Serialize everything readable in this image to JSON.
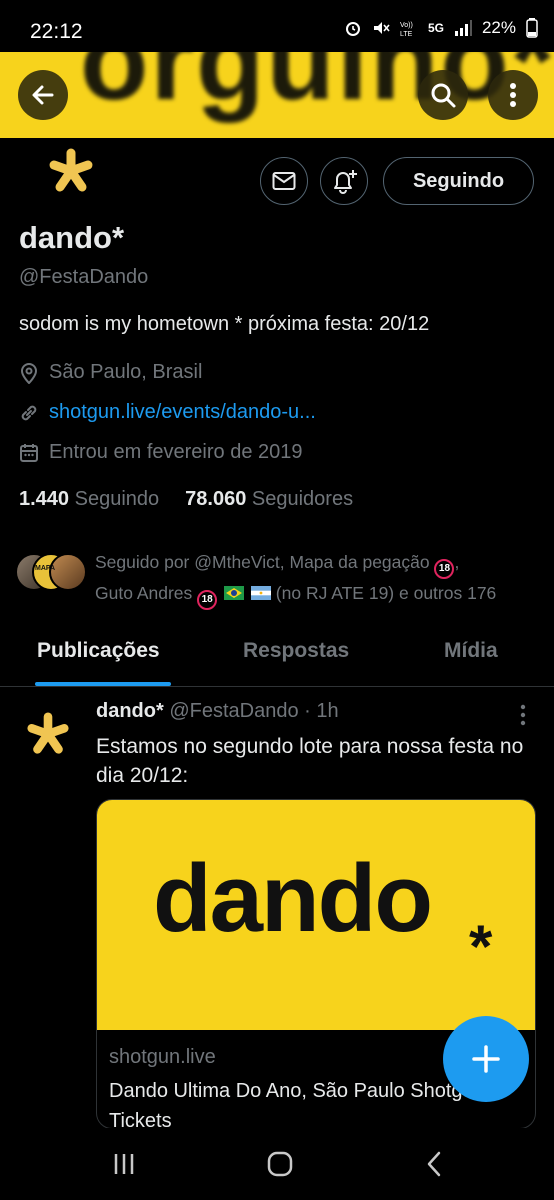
{
  "status_bar": {
    "time": "22:12",
    "battery": "22%",
    "network": "5G"
  },
  "banner": {
    "text": "orgulho*",
    "color": "#f7d31c"
  },
  "profile": {
    "display_name": "dando*",
    "handle": "@FestaDando",
    "bio": "sodom is my hometown * próxima festa: 20/12",
    "location": "São Paulo, Brasil",
    "link": "shotgun.live/events/dando-u...",
    "joined": "Entrou em fevereiro de 2019",
    "following_count": "1.440",
    "following_label": "Seguindo",
    "followers_count": "78.060",
    "followers_label": "Seguidores",
    "follow_button": "Seguindo",
    "followed_by_line1": "Seguido por @MtheVict, Mapa da pegação",
    "followed_by_line2_a": "Guto Andres",
    "followed_by_line2_b": "(no RJ ATE 19) e outros 176",
    "badge_18": "18",
    "followed_avatar_badge": "MAPA"
  },
  "tabs": [
    {
      "label": "Publicações",
      "active": true
    },
    {
      "label": "Respostas",
      "active": false
    },
    {
      "label": "Mídia",
      "active": false
    }
  ],
  "post": {
    "name": "dando*",
    "handle": "@FestaDando",
    "time": "· 1h",
    "text": "Estamos no segundo lote para nossa festa no dia 20/12:",
    "card": {
      "logo": "dando",
      "asterisk": "*",
      "domain": "shotgun.live",
      "title": "Dando Ultima Do Ano, São Paulo Shotgun Tickets"
    }
  },
  "icons": {
    "back": "arrow-left-icon",
    "search": "search-icon",
    "more": "more-vertical-icon",
    "message": "envelope-icon",
    "notify": "bell-plus-icon",
    "location": "location-pin-icon",
    "link": "link-icon",
    "calendar": "calendar-icon",
    "compose": "plus-icon"
  },
  "colors": {
    "accent": "#1d9bf0",
    "banner": "#f7d31c",
    "background": "#000000",
    "muted": "#71767b"
  }
}
